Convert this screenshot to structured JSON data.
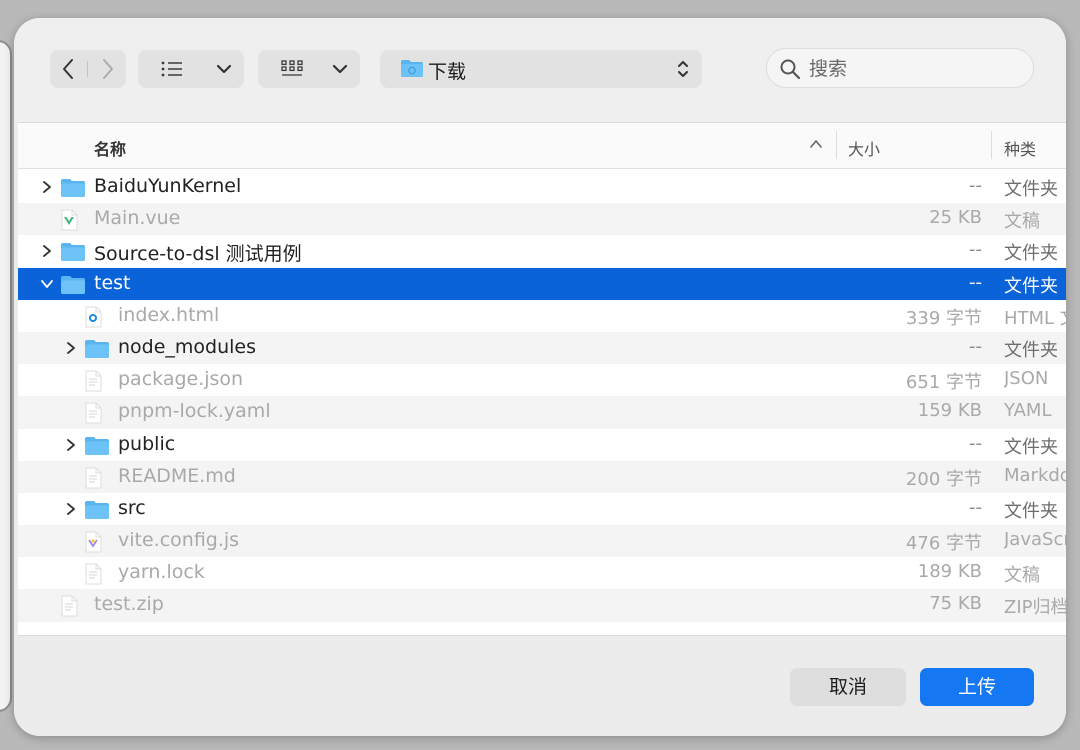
{
  "toolbar": {
    "back_icon": "chevron-left-icon",
    "forward_icon": "chevron-right-icon",
    "list_view_icon": "list-icon",
    "grid_view_icon": "grid-icon",
    "location": "下载",
    "search_placeholder": "搜索"
  },
  "columns": {
    "name": "名称",
    "size": "大小",
    "kind": "种类"
  },
  "files": [
    {
      "name": "BaiduYunKernel",
      "size": "--",
      "kind": "文件夹",
      "type": "folder",
      "level": 0,
      "disclosure": "collapsed",
      "dim": false
    },
    {
      "name": "Main.vue",
      "size": "25 KB",
      "kind": "文稿",
      "type": "vue",
      "level": 0,
      "disclosure": "none",
      "dim": true
    },
    {
      "name": "Source-to-dsl 测试用例",
      "size": "--",
      "kind": "文件夹",
      "type": "folder",
      "level": 0,
      "disclosure": "collapsed",
      "dim": false
    },
    {
      "name": "test",
      "size": "--",
      "kind": "文件夹",
      "type": "folder",
      "level": 0,
      "disclosure": "expanded",
      "dim": false,
      "selected": true
    },
    {
      "name": "index.html",
      "size": "339 字节",
      "kind": "HTML 文稿",
      "type": "html",
      "level": 1,
      "disclosure": "none",
      "dim": true
    },
    {
      "name": "node_modules",
      "size": "--",
      "kind": "文件夹",
      "type": "folder",
      "level": 1,
      "disclosure": "collapsed",
      "dim": false
    },
    {
      "name": "package.json",
      "size": "651 字节",
      "kind": "JSON",
      "type": "doc",
      "level": 1,
      "disclosure": "none",
      "dim": true
    },
    {
      "name": "pnpm-lock.yaml",
      "size": "159 KB",
      "kind": "YAML",
      "type": "doc",
      "level": 1,
      "disclosure": "none",
      "dim": true
    },
    {
      "name": "public",
      "size": "--",
      "kind": "文件夹",
      "type": "folder",
      "level": 1,
      "disclosure": "collapsed",
      "dim": false
    },
    {
      "name": "README.md",
      "size": "200 字节",
      "kind": "Markdown",
      "type": "doc",
      "level": 1,
      "disclosure": "none",
      "dim": true
    },
    {
      "name": "src",
      "size": "--",
      "kind": "文件夹",
      "type": "folder",
      "level": 1,
      "disclosure": "collapsed",
      "dim": false
    },
    {
      "name": "vite.config.js",
      "size": "476 字节",
      "kind": "JavaScript",
      "type": "js",
      "level": 1,
      "disclosure": "none",
      "dim": true
    },
    {
      "name": "yarn.lock",
      "size": "189 KB",
      "kind": "文稿",
      "type": "doc",
      "level": 1,
      "disclosure": "none",
      "dim": true
    },
    {
      "name": "test.zip",
      "size": "75 KB",
      "kind": "ZIP归档",
      "type": "doc",
      "level": 0,
      "disclosure": "none",
      "dim": true
    }
  ],
  "buttons": {
    "cancel": "取消",
    "upload": "上传"
  },
  "colors": {
    "selection": "#0a63d8",
    "primary_button": "#1577f2",
    "folder": "#5ab4ef"
  }
}
